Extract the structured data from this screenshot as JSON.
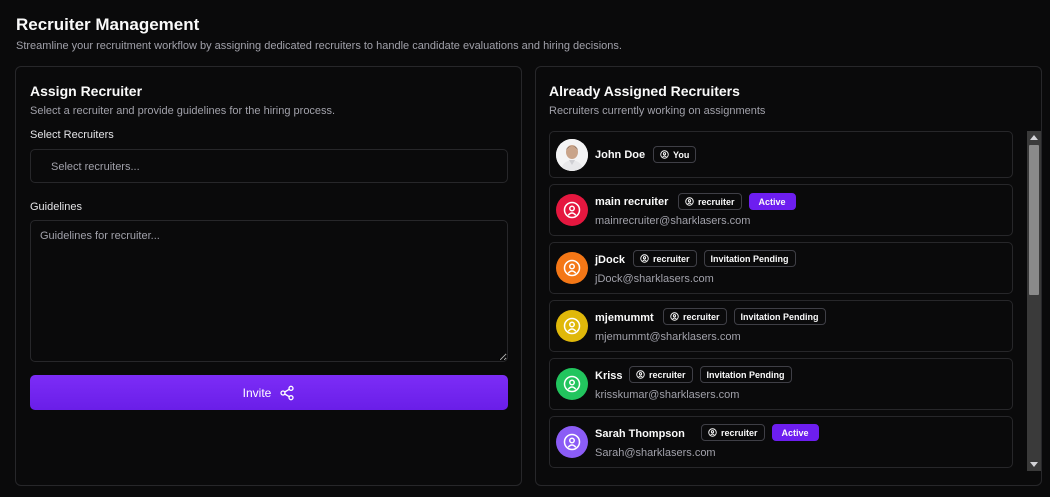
{
  "header": {
    "title": "Recruiter Management",
    "subtitle": "Streamline your recruitment workflow by assigning dedicated recruiters to handle candidate evaluations and hiring decisions."
  },
  "assign": {
    "title": "Assign Recruiter",
    "subtitle": "Select a recruiter and provide guidelines for the hiring process.",
    "select_label": "Select Recruiters",
    "select_placeholder": "Select recruiters...",
    "guidelines_label": "Guidelines",
    "guidelines_placeholder": "Guidelines for recruiter...",
    "invite_label": "Invite",
    "accent_color": "#6d1ef0"
  },
  "assigned": {
    "title": "Already Assigned Recruiters",
    "subtitle": "Recruiters currently working on assignments",
    "items": [
      {
        "name": "John Doe",
        "badges": [
          {
            "label": "You",
            "icon": "user-circle-icon"
          }
        ],
        "email": "",
        "avatar": "photo",
        "avatar_color": "#d4d4d8"
      },
      {
        "name": "main recruiter",
        "badges": [
          {
            "label": "recruiter",
            "icon": "user-circle-icon"
          },
          {
            "label": "Active"
          }
        ],
        "email": "mainrecruiter@sharklasers.com",
        "avatar": "user-icon",
        "avatar_color": "#e5173f"
      },
      {
        "name": "jDock",
        "badges": [
          {
            "label": "recruiter",
            "icon": "user-circle-icon"
          },
          {
            "label": "Invitation Pending"
          }
        ],
        "email": "jDock@sharklasers.com",
        "avatar": "user-icon",
        "avatar_color": "#f47716"
      },
      {
        "name": "mjemummt",
        "badges": [
          {
            "label": "recruiter",
            "icon": "user-circle-icon"
          },
          {
            "label": "Invitation Pending"
          }
        ],
        "email": "mjemummt@sharklasers.com",
        "avatar": "user-icon",
        "avatar_color": "#e0b80a"
      },
      {
        "name": "Kriss",
        "badges": [
          {
            "label": "recruiter",
            "icon": "user-circle-icon"
          },
          {
            "label": "Invitation Pending"
          }
        ],
        "email": "krisskumar@sharklasers.com",
        "avatar": "user-icon",
        "avatar_color": "#22c55e"
      },
      {
        "name": "Sarah Thompson",
        "badges": [
          {
            "label": "recruiter",
            "icon": "user-circle-icon"
          },
          {
            "label": "Active"
          }
        ],
        "email": "Sarah@sharklasers.com",
        "avatar": "user-icon",
        "avatar_color": "#8b5cf6"
      }
    ]
  }
}
